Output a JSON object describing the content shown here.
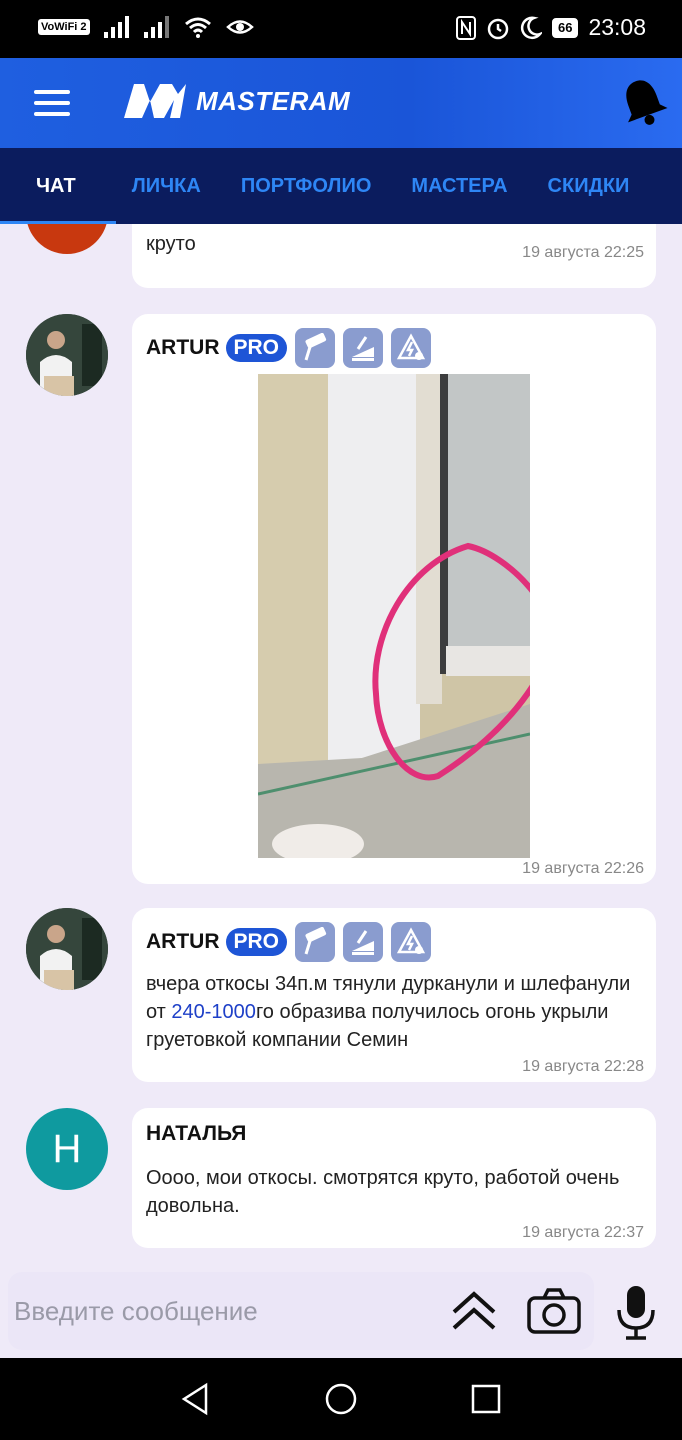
{
  "status": {
    "vowifi": "VoWiFi",
    "vowifi_sub": "2",
    "battery": "66",
    "time": "23:08"
  },
  "header": {
    "logo_text": "MASTERAM"
  },
  "tabs": [
    "ЧАТ",
    "ЛИЧКА",
    "ПОРТФОЛИО",
    "МАСТЕРА",
    "СКИДКИ"
  ],
  "messages": [
    {
      "text": "круто",
      "time": "19 августа 22:25"
    },
    {
      "author": "ARTUR",
      "badge": "PRO",
      "time": "19 августа 22:26"
    },
    {
      "author": "ARTUR",
      "badge": "PRO",
      "text_before": "вчера откосы 34п.м тянули дурканули и шлефанули от ",
      "text_link": "240-1000",
      "text_after": "го образива получилось огонь укрыли груетовкой компании Семин",
      "time": "19 августа 22:28"
    },
    {
      "author": "НАТАЛЬЯ",
      "initial": "Н",
      "text": "Оооо, мои откосы. смотрятся круто, работой очень довольна.",
      "time": "19 августа 22:37"
    }
  ],
  "composer": {
    "placeholder": "Введите сообщение"
  },
  "colors": {
    "header_blue": "#1f5fe0",
    "tabs_navy": "#0b1c5e",
    "tab_link": "#2e86f5",
    "pro_badge": "#1e55d6",
    "avatar_teal": "#0f9a9f",
    "avatar_red": "#c8380f",
    "feed_bg": "#efeaf8",
    "annotation_pink": "#e0307a"
  },
  "icons": [
    "menu-icon",
    "bell-icon",
    "roller-icon",
    "trowel-icon",
    "electric-icon",
    "scroll-up-icon",
    "camera-icon",
    "microphone-icon",
    "back-icon",
    "home-icon",
    "recents-icon"
  ]
}
